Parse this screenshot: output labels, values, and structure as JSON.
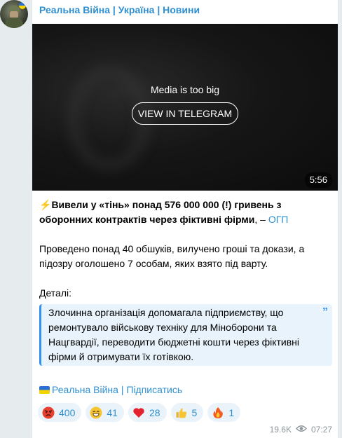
{
  "channel": {
    "title": "Реальна Війна | Україна | Новини"
  },
  "media": {
    "note": "Media is too big",
    "button_label": "VIEW IN TELEGRAM",
    "duration": "5:56"
  },
  "post": {
    "headline_bold": "Вивели у «тінь» понад 576 000 000 (!) гривень з оборонних контрактів через фіктивні фірми",
    "headline_sep": ", – ",
    "source_link": "ОГП",
    "paragraph2": "Проведено понад 40 обшуків, вилучено гроші та докази, а підозру оголошено 7 особам, яких взято під варту.",
    "details_label": "Деталі:",
    "quote": "Злочинна організація допомагала підприємству, що ремонтувало військову техніку для Міноборони та Нацгвардії, переводити бюджетні кошти через фіктивні фірми й отримувати їх готівкою.",
    "footer_channel": "Реальна Війна",
    "footer_sep": " | ",
    "footer_subscribe": "Підписатись"
  },
  "reactions": [
    {
      "icon": "angry-face-icon",
      "count": "400"
    },
    {
      "icon": "grinning-face-icon",
      "count": "41"
    },
    {
      "icon": "red-heart-icon",
      "count": "28"
    },
    {
      "icon": "thumbs-up-icon",
      "count": "5"
    },
    {
      "icon": "fire-icon",
      "count": "1"
    }
  ],
  "meta": {
    "views": "19.6K",
    "time": "07:27"
  },
  "colors": {
    "accent": "#2e8fd1",
    "background": "#e6ebee",
    "quote_bg": "#e9f3fb"
  }
}
